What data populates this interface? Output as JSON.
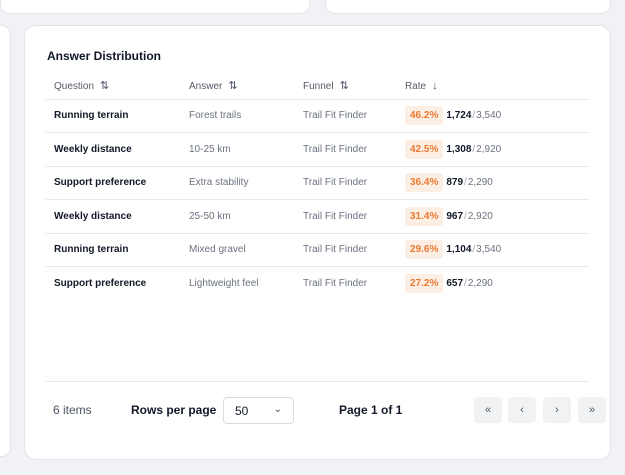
{
  "panel": {
    "title": "Answer Distribution"
  },
  "table": {
    "columns": [
      {
        "label": "Question",
        "sort_icon": "sort-both-icon"
      },
      {
        "label": "Answer",
        "sort_icon": "sort-both-icon"
      },
      {
        "label": "Funnel",
        "sort_icon": "sort-both-icon"
      },
      {
        "label": "Rate",
        "sort_icon": "sort-desc-icon"
      }
    ],
    "rows": [
      {
        "question": "Running terrain",
        "answer": "Forest trails",
        "funnel": "Trail Fit Finder",
        "rate": "46.2%",
        "count": "1,724",
        "total": "3,540"
      },
      {
        "question": "Weekly distance",
        "answer": "10-25 km",
        "funnel": "Trail Fit Finder",
        "rate": "42.5%",
        "count": "1,308",
        "total": "2,920"
      },
      {
        "question": "Support preference",
        "answer": "Extra stability",
        "funnel": "Trail Fit Finder",
        "rate": "36.4%",
        "count": "879",
        "total": "2,290"
      },
      {
        "question": "Weekly distance",
        "answer": "25-50 km",
        "funnel": "Trail Fit Finder",
        "rate": "31.4%",
        "count": "967",
        "total": "2,920"
      },
      {
        "question": "Running terrain",
        "answer": "Mixed gravel",
        "funnel": "Trail Fit Finder",
        "rate": "29.6%",
        "count": "1,104",
        "total": "3,540"
      },
      {
        "question": "Support preference",
        "answer": "Lightweight feel",
        "funnel": "Trail Fit Finder",
        "rate": "27.2%",
        "count": "657",
        "total": "2,290"
      }
    ]
  },
  "footer": {
    "items_count": "6 items",
    "rows_per_page_label": "Rows per page",
    "rows_per_page_value": "50",
    "page_label": "Page 1 of 1",
    "pager": {
      "first": "«",
      "prev": "‹",
      "next": "›",
      "last": "»"
    }
  },
  "colors": {
    "rate_badge_bg": "#fdeee4",
    "rate_badge_text": "#ea7a32"
  }
}
